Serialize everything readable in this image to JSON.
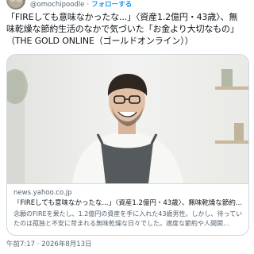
{
  "header": {
    "handle": "@omochipoodle",
    "separator": "·",
    "follow_label": "フォローする"
  },
  "tweet": {
    "lines": [
      "「FIREしても意味なかったな...」〈資産1.2億円・43歳〉、無",
      "味乾燥な節約生活のなかで気づいた「お金より大切なもの」",
      "（THE GOLD ONLINE（ゴールドオンライン））"
    ]
  },
  "card": {
    "domain": "news.yahoo.co.jp",
    "title": "「FIREしても意味なかったな...」〈資産1.2億円・43歳〉、無味乾燥な節約...",
    "description": "念願のFIREを果たし、1.2億円の資産を手に入れた43歳男性。しかし、待っていたのは孤独と不安に苛まれる無味乾燥な日々でした。適度な節約や人間関..."
  },
  "timestamp": "午前7:17 · 2026年8月13日",
  "colors": {
    "link": "#1d9bf0",
    "secondary_text": "#536471",
    "border": "#cfd9de"
  }
}
